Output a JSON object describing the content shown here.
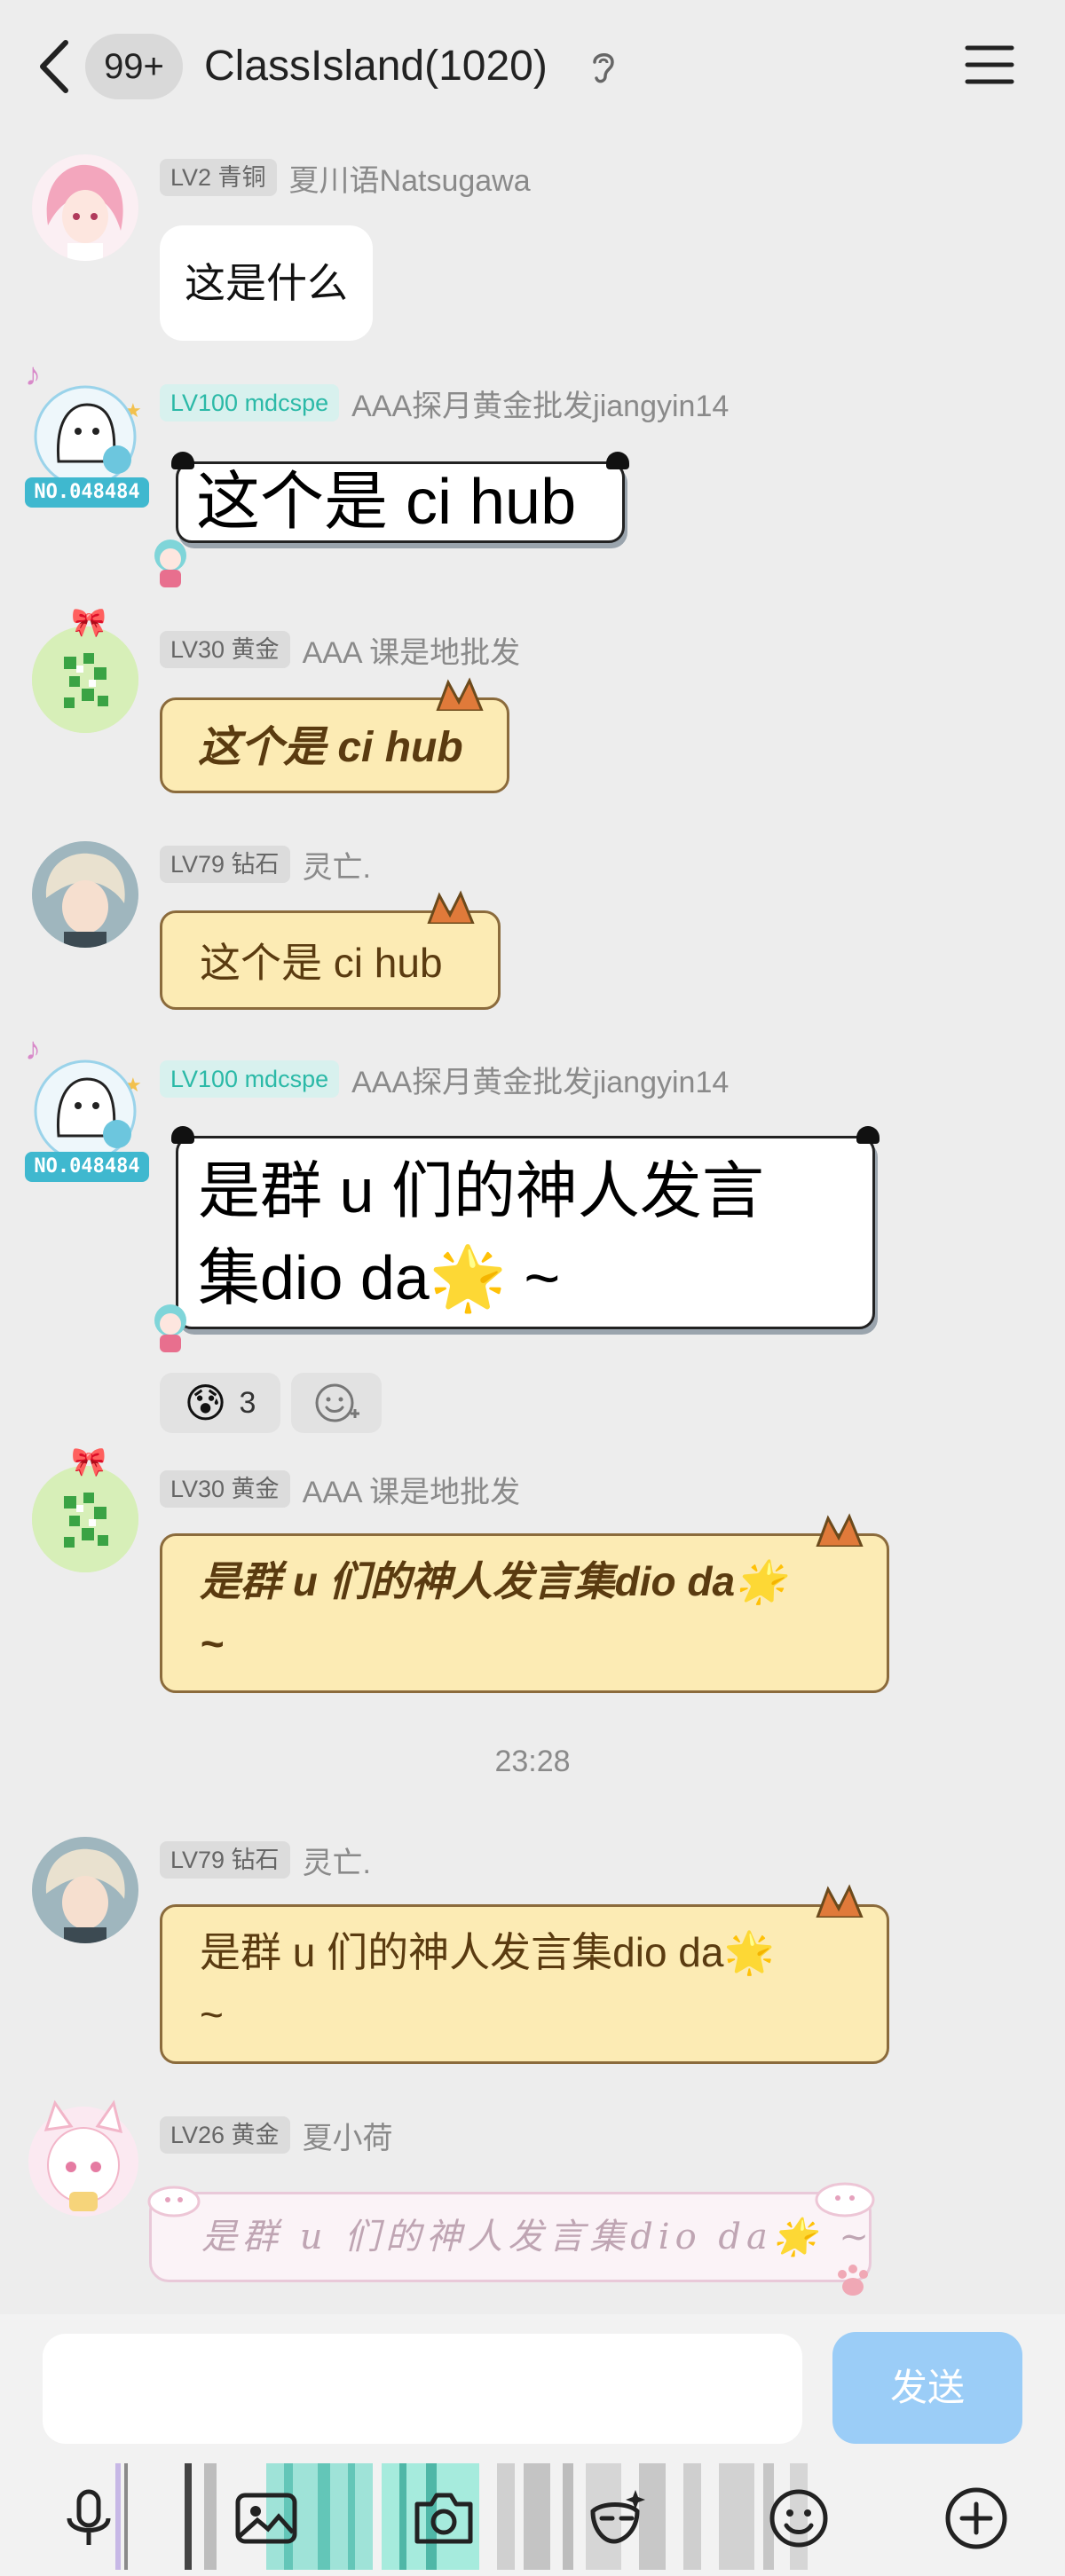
{
  "header": {
    "badge": "99+",
    "title": "ClassIsland(1020)"
  },
  "messages": [
    {
      "level": "LV2 青铜",
      "name": "夏川语Natsugawa",
      "text": "这是什么"
    },
    {
      "level": "LV100 mdcspe",
      "name": "AAA探月黄金批发jiangyin14",
      "text": "这个是 ci hub",
      "avatar_badge": "NO.048484"
    },
    {
      "level": "LV30 黄金",
      "name": "AAA 课是地批发",
      "text": "这个是 ci hub"
    },
    {
      "level": "LV79 钻石",
      "name": "灵亡.",
      "text": "这个是 ci hub"
    },
    {
      "level": "LV100 mdcspe",
      "name": "AAA探月黄金批发jiangyin14",
      "text_line1": "是群 u 们的神人发言",
      "text_line2": "集dio da🌟 ~",
      "avatar_badge": "NO.048484",
      "reaction_emoji": "😰",
      "reaction_count": "3"
    },
    {
      "level": "LV30 黄金",
      "name": "AAA 课是地批发",
      "text_line1": "是群 u 们的神人发言集dio da🌟",
      "text_line2": "~"
    },
    {
      "level": "LV79 钻石",
      "name": "灵亡.",
      "text_line1": "是群 u 们的神人发言集dio da🌟",
      "text_line2": "~"
    },
    {
      "level": "LV26 黄金",
      "name": "夏小荷",
      "text": "是群 u 们的神人发言集dio da🌟 ~"
    }
  ],
  "timestamp": "23:28",
  "input": {
    "placeholder": "",
    "send_label": "发送"
  },
  "toolbar": [
    "mic-icon",
    "image-icon",
    "camera-icon",
    "effects-icon",
    "emoji-icon",
    "plus-icon"
  ]
}
